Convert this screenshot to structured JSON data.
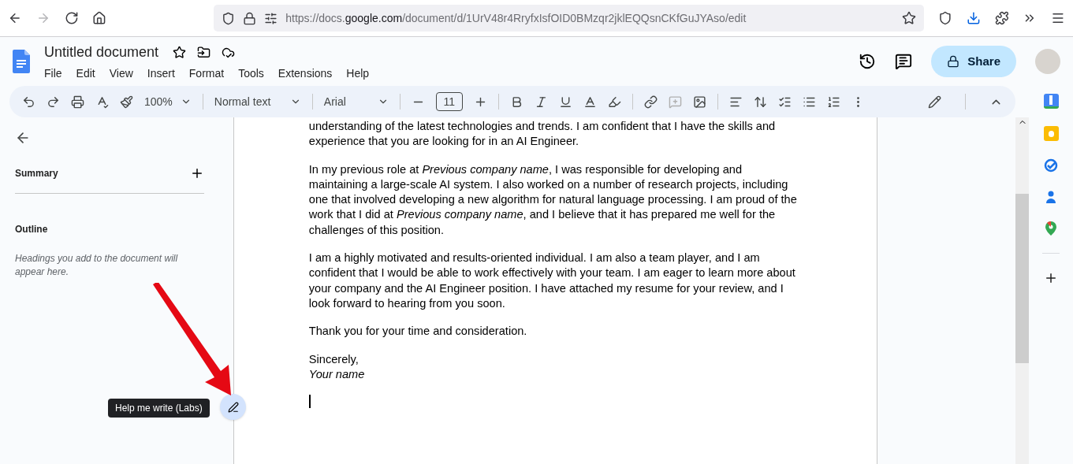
{
  "browser": {
    "url_prefix": "https://docs.",
    "url_domain": "google.com",
    "url_path": "/document/d/1UrV48r4RryfxIsfOID0BMzqr2jklEQQsnCKfGuJYAso/edit"
  },
  "document": {
    "title": "Untitled document",
    "menu": [
      "File",
      "Edit",
      "View",
      "Insert",
      "Format",
      "Tools",
      "Extensions",
      "Help"
    ],
    "share_label": "Share"
  },
  "toolbar": {
    "zoom": "100%",
    "style": "Normal text",
    "font": "Arial",
    "font_size": "11"
  },
  "sidebar": {
    "summary": "Summary",
    "outline": "Outline",
    "outline_hint": "Headings you add to the document will appear here."
  },
  "paragraphs": [
    {
      "kind": "text",
      "text": "understanding of the latest technologies and trends. I am confident that I have the skills and experience that you are looking for in an AI Engineer."
    },
    {
      "kind": "text",
      "text": "In my previous role at *Previous company name*, I was responsible for developing and maintaining a large-scale AI system. I also worked on a number of research projects, including one that involved developing a new algorithm for natural language processing. I am proud of the work that I did at *Previous company name*, and I believe that it has prepared me well for the challenges of this position."
    },
    {
      "kind": "text",
      "text": "I am a highly motivated and results-oriented individual. I am also a team player, and I am confident that I would be able to work effectively with your team. I am eager to learn more about your company and the AI Engineer position. I have attached my resume for your review, and I look forward to hearing from you soon."
    },
    {
      "kind": "text",
      "text": "Thank you for your time and consideration."
    },
    {
      "kind": "signature",
      "closing": "Sincerely,",
      "name": "Your name"
    }
  ],
  "tooltip": "Help me write (Labs)"
}
